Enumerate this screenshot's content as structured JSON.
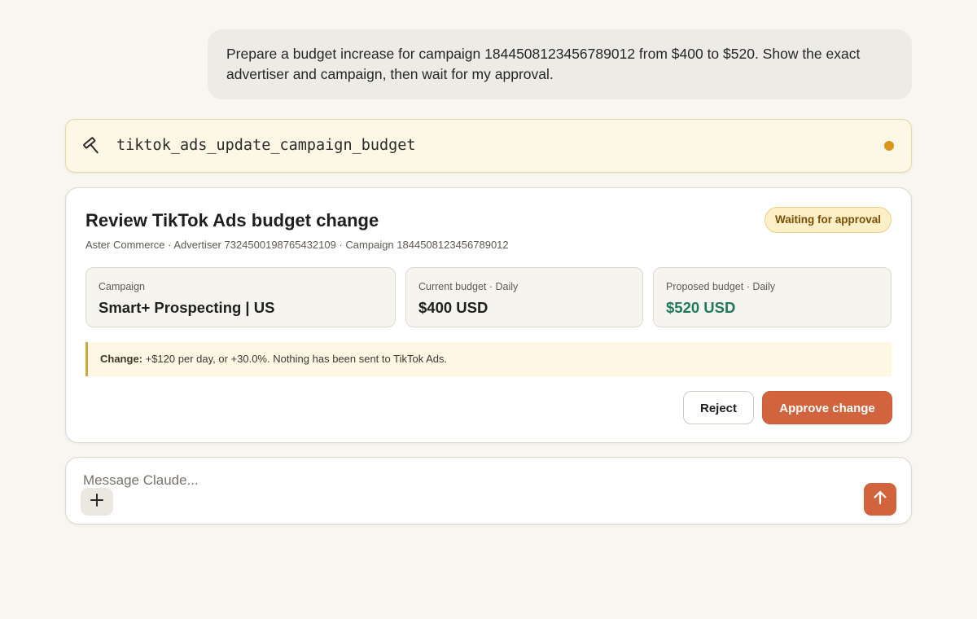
{
  "conversation": {
    "user_message": "Prepare a budget increase for campaign 1844508123456789012 from $400 to $520. Show the exact advertiser and campaign, then wait for my approval."
  },
  "tool_call": {
    "icon": "hammer-icon",
    "name": "tiktok_ads_update_campaign_budget",
    "status_color": "#d8961c"
  },
  "review": {
    "title": "Review TikTok Ads budget change",
    "subtitle": "Aster Commerce · Advertiser 7324500198765432109 · Campaign 1844508123456789012",
    "status": "Waiting for approval",
    "campaign": {
      "label": "Campaign",
      "value": "Smart+ Prospecting | US"
    },
    "current_budget": {
      "label": "Current budget · Daily",
      "value": "$400 USD"
    },
    "proposed_budget": {
      "label": "Proposed budget · Daily",
      "value": "$520 USD"
    },
    "change_label": "Change:",
    "change_text": " +$120 per day, or +30.0%. Nothing has been sent to TikTok Ads.",
    "reject_label": "Reject",
    "approve_label": "Approve change"
  },
  "composer": {
    "placeholder": "Message Claude...",
    "add_icon": "plus-icon",
    "send_icon": "arrow-up-icon"
  },
  "colors": {
    "accent": "#d2643d",
    "positive": "#1f7a5a",
    "warning": "#d4a53a",
    "background": "#f8f6f1"
  }
}
